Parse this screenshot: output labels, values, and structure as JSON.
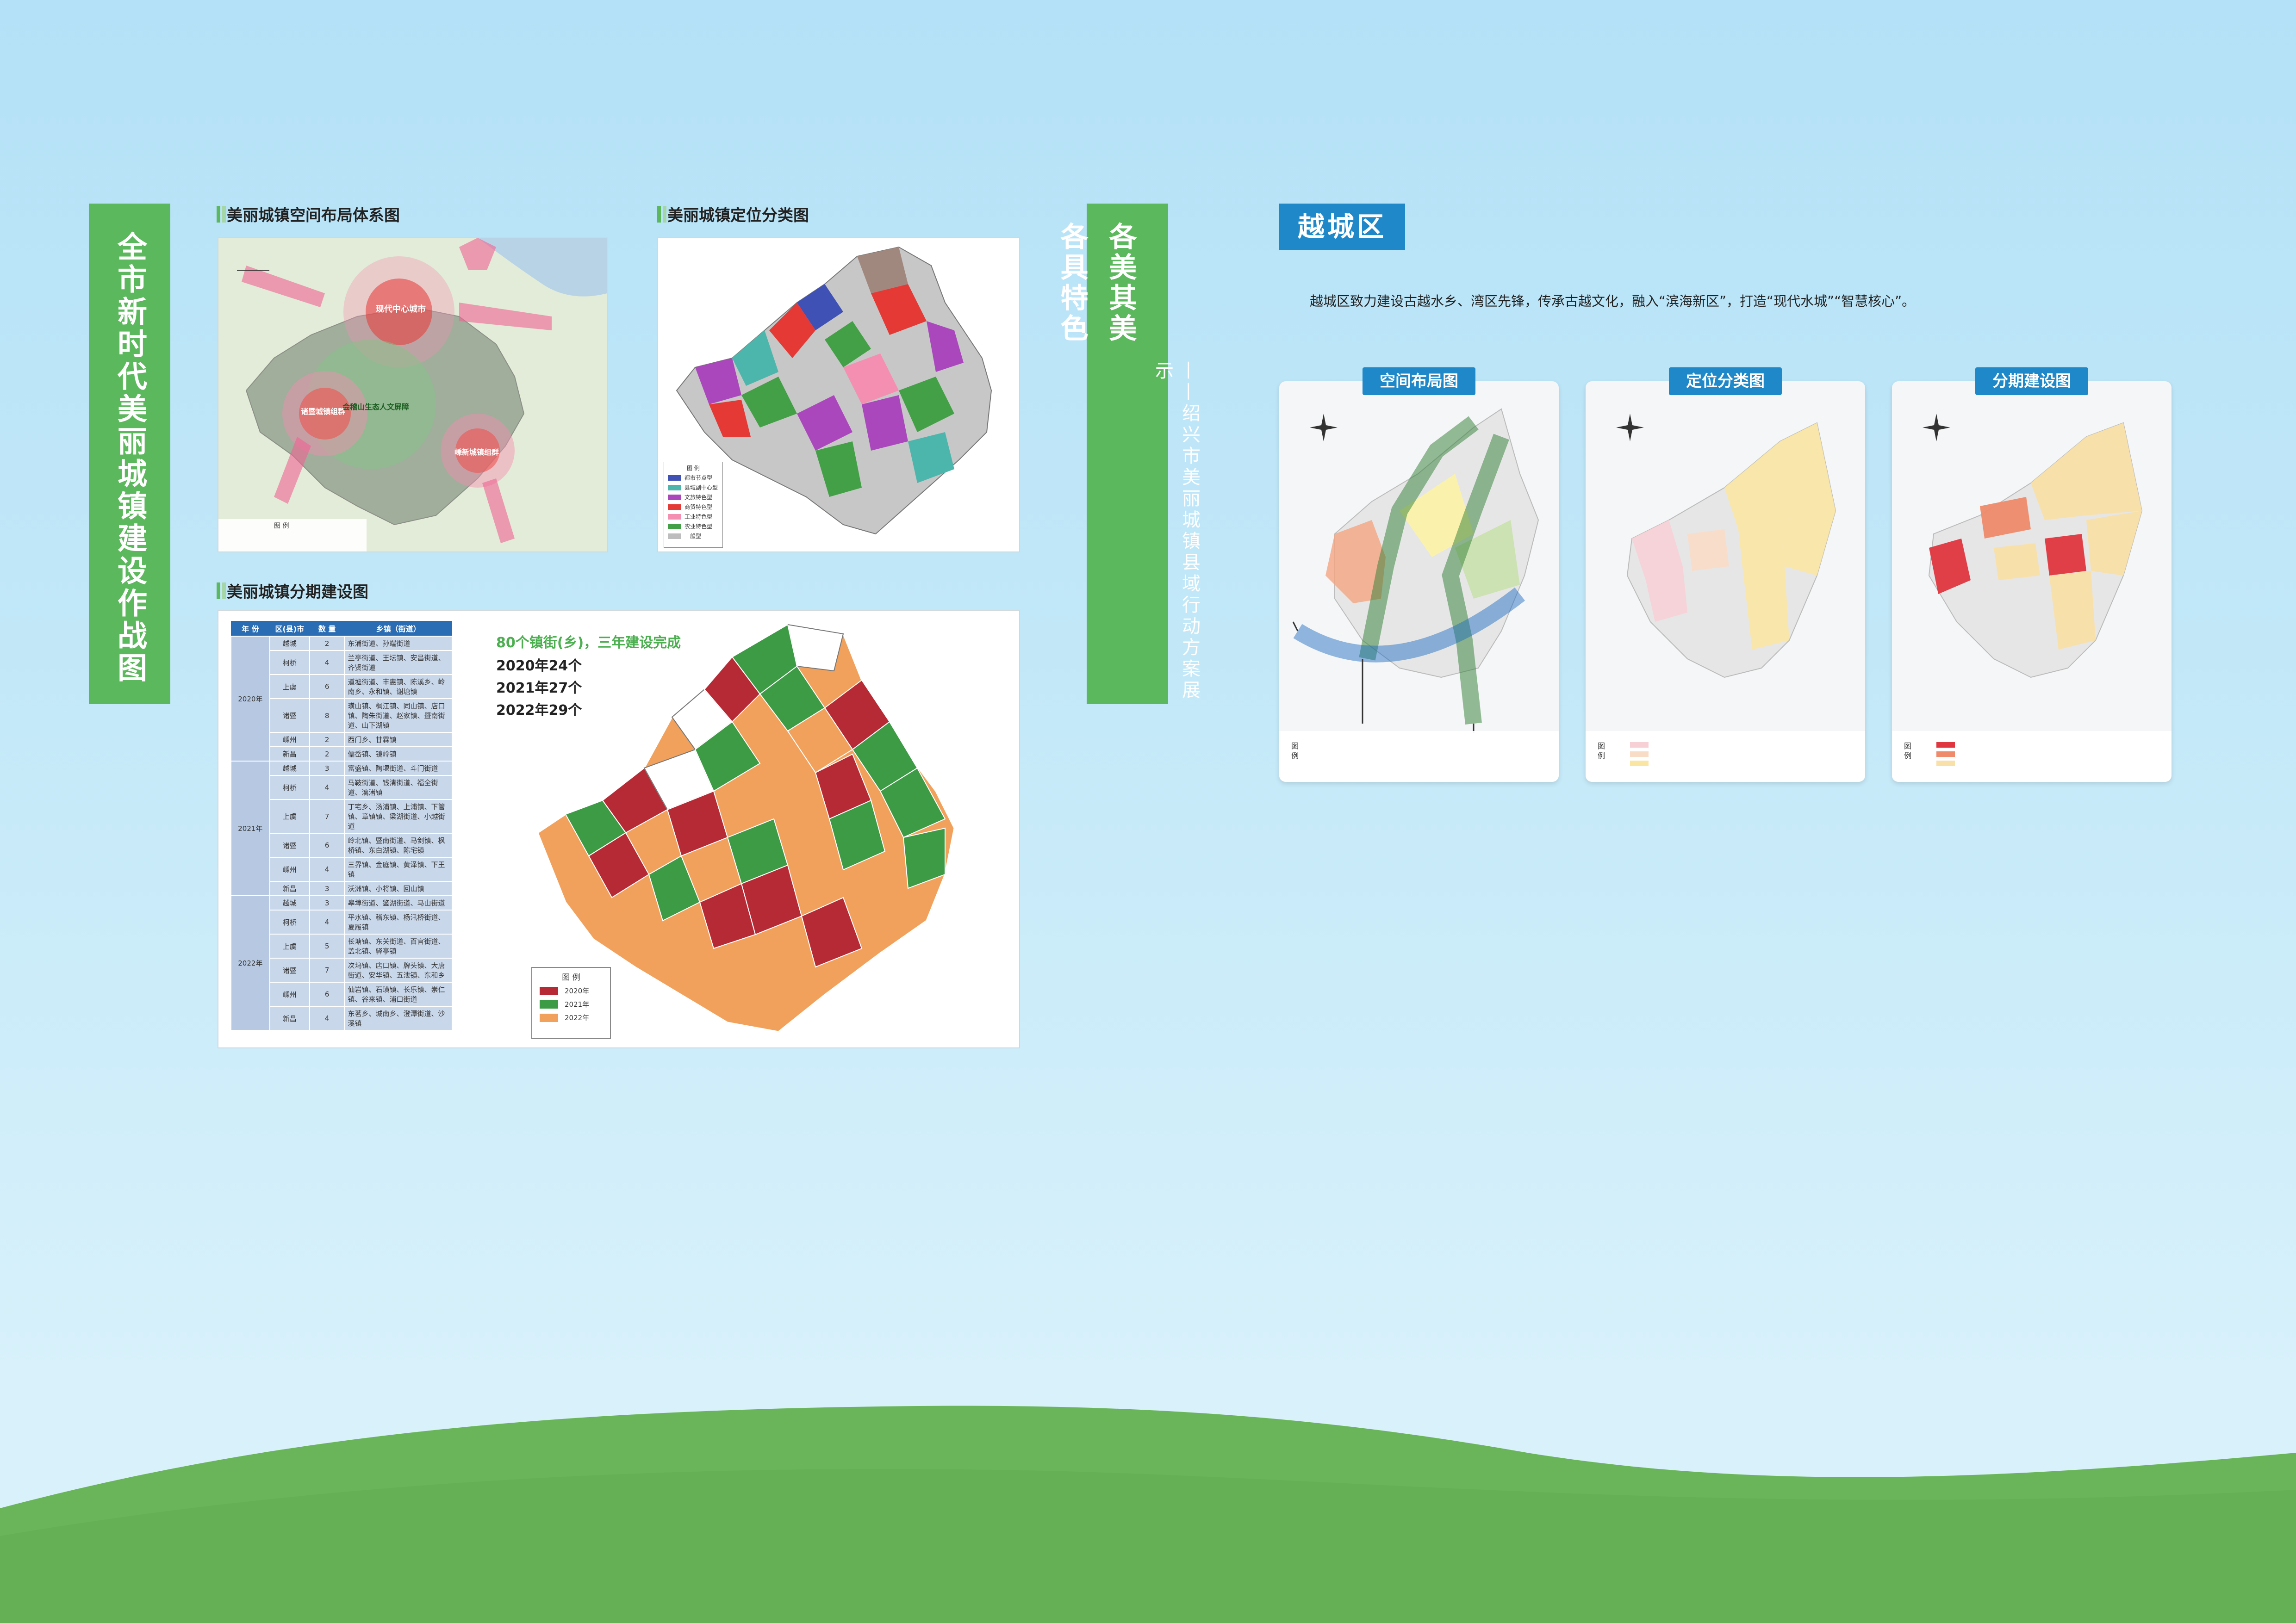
{
  "left_banner": {
    "title": "全市新时代美丽城镇建设作战图"
  },
  "middle_banner": {
    "title_line1": "各具特色",
    "title_line2": "各美其美",
    "subtitle": "——绍兴市美丽城镇县域行动方案展示"
  },
  "section_spatial": {
    "title": "美丽城镇空间布局体系图",
    "labels": {
      "core": "现代中心城市",
      "east": "嵊新城镇组群",
      "west": "诸暨城镇组群",
      "ecology": "会稽山生态人文屏障"
    },
    "legend_title": "图 例"
  },
  "section_position": {
    "title": "美丽城镇定位分类图",
    "legend_title": "图 例",
    "legend": [
      {
        "label": "都市节点型",
        "color": "#3f51b5"
      },
      {
        "label": "县域副中心型",
        "color": "#4db6ac"
      },
      {
        "label": "文旅特色型",
        "color": "#ab47bc"
      },
      {
        "label": "商贸特色型",
        "color": "#e53935"
      },
      {
        "label": "工业特色型",
        "color": "#f48fb1"
      },
      {
        "label": "农业特色型",
        "color": "#43a047"
      },
      {
        "label": "一般型",
        "color": "#bdbdbd"
      }
    ]
  },
  "section_phase": {
    "title": "美丽城镇分期建设图",
    "headline": "80个镇街(乡)，三年建设完成",
    "stats": [
      "2020年24个",
      "2021年27个",
      "2022年29个"
    ],
    "legend_title": "图 例",
    "legend": [
      {
        "label": "2020年",
        "color": "#b52a35"
      },
      {
        "label": "2021年",
        "color": "#3d9a45"
      },
      {
        "label": "2022年",
        "color": "#f2a15c"
      }
    ],
    "table": {
      "headers": [
        "年 份",
        "区(县)市",
        "数 量",
        "乡镇（街道）"
      ],
      "groups": [
        {
          "year": "2020年",
          "rows": [
            {
              "district": "越城",
              "count": "2",
              "towns": "东浦街道、孙端街道"
            },
            {
              "district": "柯桥",
              "count": "4",
              "towns": "兰亭街道、王坛镇、安昌街道、齐贤街道"
            },
            {
              "district": "上虞",
              "count": "6",
              "towns": "道墟街道、丰惠镇、陈溪乡、岭南乡、永和镇、谢塘镇"
            },
            {
              "district": "诸暨",
              "count": "8",
              "towns": "璜山镇、枫江镇、同山镇、店口镇、陶朱街道、赵家镇、暨南街道、山下湖镇"
            },
            {
              "district": "嵊州",
              "count": "2",
              "towns": "西门乡、甘霖镇"
            },
            {
              "district": "新昌",
              "count": "2",
              "towns": "儒岙镇、镜岭镇"
            }
          ]
        },
        {
          "year": "2021年",
          "rows": [
            {
              "district": "越城",
              "count": "3",
              "towns": "富盛镇、陶堰街道、斗门街道"
            },
            {
              "district": "柯桥",
              "count": "4",
              "towns": "马鞍街道、钱清街道、福全街道、漓渚镇"
            },
            {
              "district": "上虞",
              "count": "7",
              "towns": "丁宅乡、汤浦镇、上浦镇、下管镇、章镇镇、梁湖街道、小越街道"
            },
            {
              "district": "诸暨",
              "count": "6",
              "towns": "岭北镇、暨南街道、马剑镇、枫桥镇、东白湖镇、陈宅镇"
            },
            {
              "district": "嵊州",
              "count": "4",
              "towns": "三界镇、金庭镇、黄泽镇、下王镇"
            },
            {
              "district": "新昌",
              "count": "3",
              "towns": "沃洲镇、小将镇、回山镇"
            }
          ]
        },
        {
          "year": "2022年",
          "rows": [
            {
              "district": "越城",
              "count": "3",
              "towns": "皋埠街道、鉴湖街道、马山街道"
            },
            {
              "district": "柯桥",
              "count": "4",
              "towns": "平水镇、稽东镇、杨汛桥街道、夏履镇"
            },
            {
              "district": "上虞",
              "count": "5",
              "towns": "长塘镇、东关街道、百官街道、盖北镇、驿亭镇"
            },
            {
              "district": "诸暨",
              "count": "7",
              "towns": "次坞镇、店口镇、牌头镇、大唐街道、安华镇、五泄镇、东和乡"
            },
            {
              "district": "嵊州",
              "count": "6",
              "towns": "仙岩镇、石璜镇、长乐镇、崇仁镇、谷来镇、浦口街道"
            },
            {
              "district": "新昌",
              "count": "4",
              "towns": "东茗乡、城南乡、澄潭街道、沙溪镇"
            }
          ]
        }
      ]
    }
  },
  "yuecheng": {
    "title": "越城区",
    "description": "越城区致力建设古越水乡、湾区先锋，传承古越文化，融入“滨海新区”，打造“现代水城”“智慧核心”。",
    "cards": [
      {
        "tab": "空间布局图",
        "legend_label": "图 例"
      },
      {
        "tab": "定位分类图",
        "legend_label": "图 例"
      },
      {
        "tab": "分期建设图",
        "legend_label": "图 例"
      }
    ]
  }
}
